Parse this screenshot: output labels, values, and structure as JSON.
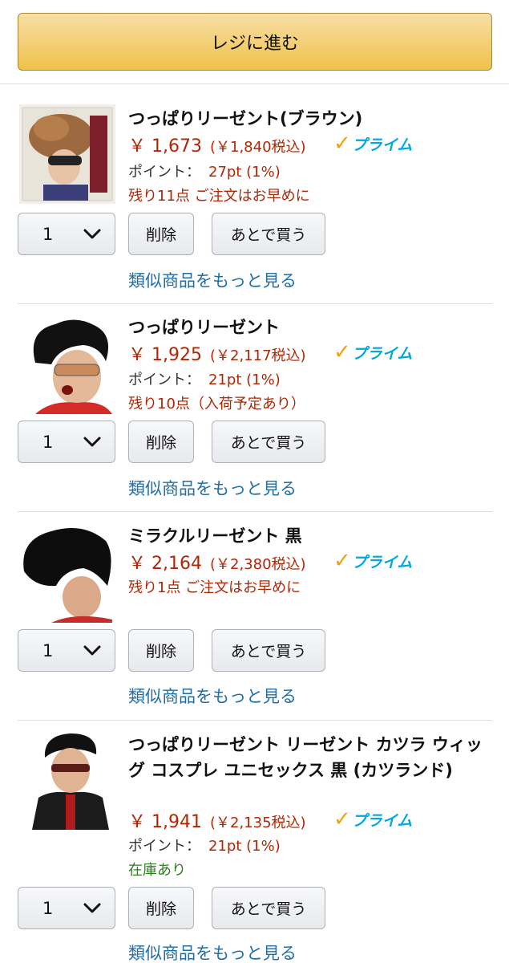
{
  "checkout": {
    "label": "レジに進む"
  },
  "common": {
    "delete_label": "削除",
    "save_later_label": "あとで買う",
    "similar_label": "類似商品をもっと見る",
    "points_label": "ポイント：",
    "prime_label": "プライム"
  },
  "items": [
    {
      "title": "つっぱりリーゼント(ブラウン)",
      "price": "￥ 1,673",
      "price_tax": "(￥1,840税込)",
      "prime": true,
      "points": "27pt (1%)",
      "stock": "残り11点 ご注文はお早めに",
      "qty": "1"
    },
    {
      "title": "つっぱりリーゼント",
      "price": "￥ 1,925",
      "price_tax": "(￥2,117税込)",
      "prime": true,
      "points": "21pt (1%)",
      "stock": "残り10点（入荷予定あり）",
      "qty": "1"
    },
    {
      "title": "ミラクルリーゼント 黒",
      "price": "￥ 2,164",
      "price_tax": "(￥2,380税込)",
      "prime": true,
      "stock": "残り1点 ご注文はお早めに",
      "qty": "1"
    },
    {
      "title": "つっぱりリーゼント リーゼント カツラ ウィッグ コスプレ ユニセックス 黒 (カツランド)",
      "price": "￥ 1,941",
      "price_tax": "(￥2,135税込)",
      "prime": true,
      "points": "21pt (1%)",
      "stock": "在庫あり",
      "qty": "1"
    }
  ]
}
